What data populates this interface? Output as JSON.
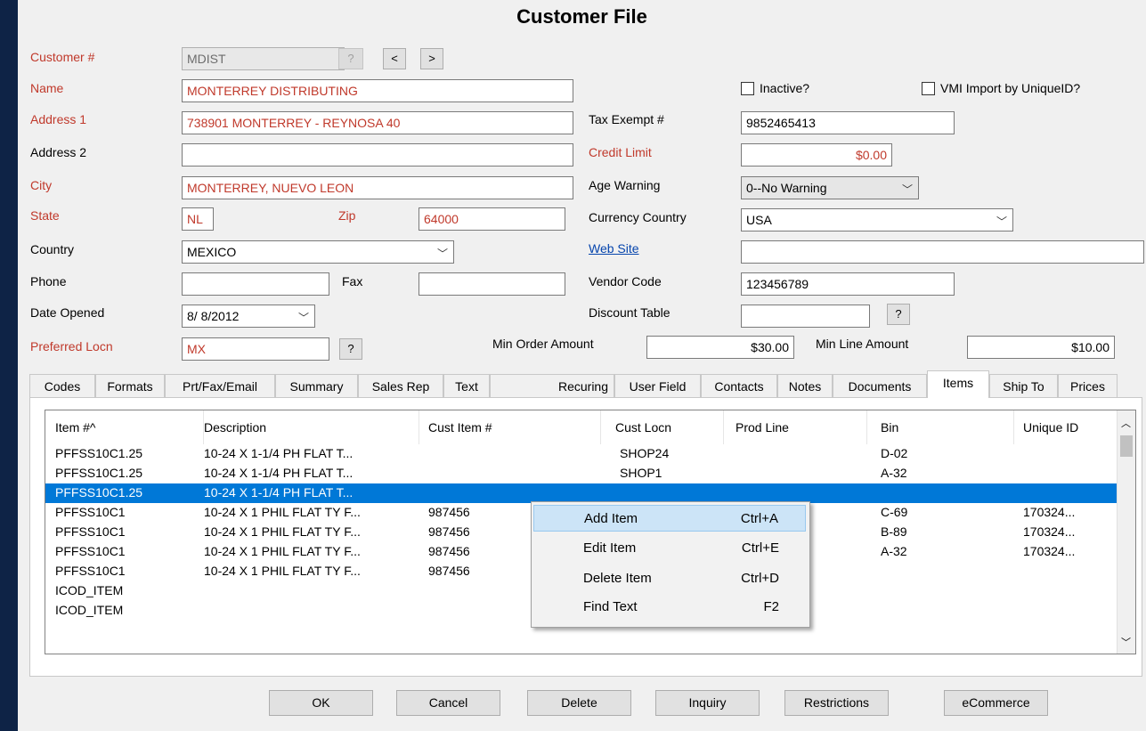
{
  "window": {
    "title": "Customer File"
  },
  "left": {
    "customer_label": "Customer #",
    "customer_value": "MDIST",
    "help": "?",
    "prev": "<",
    "next": ">",
    "name_label": "Name",
    "name_value": "MONTERREY DISTRIBUTING",
    "addr1_label": "Address 1",
    "addr1_value": "738901 MONTERREY - REYNOSA 40",
    "addr2_label": "Address 2",
    "addr2_value": "",
    "city_label": "City",
    "city_value": "MONTERREY, NUEVO LEON",
    "state_label": "State",
    "state_value": "NL",
    "zip_label": "Zip",
    "zip_value": "64000",
    "country_label": "Country",
    "country_value": "MEXICO",
    "phone_label": "Phone",
    "phone_value": "",
    "fax_label": "Fax",
    "fax_value": "",
    "date_label": "Date Opened",
    "date_value": "8/ 8/2012",
    "locn_label": "Preferred Locn",
    "locn_value": "MX"
  },
  "right": {
    "inactive_label": "Inactive?",
    "vmi_label": "VMI Import by UniqueID?",
    "tax_label": "Tax Exempt #",
    "tax_value": "9852465413",
    "credit_label": "Credit Limit",
    "credit_value": "$0.00",
    "age_label": "Age Warning",
    "age_value": "0--No Warning",
    "currency_label": "Currency Country",
    "currency_value": "USA",
    "web_label": "Web Site",
    "web_value": "",
    "vendor_label": "Vendor Code",
    "vendor_value": "123456789",
    "discount_label": "Discount Table",
    "discount_value": "",
    "minorder_label": "Min Order Amount",
    "minorder_value": "$30.00",
    "minline_label": "Min Line Amount",
    "minline_value": "$10.00"
  },
  "tabs": [
    "Codes",
    "Formats",
    "Prt/Fax/Email",
    "Summary",
    "Sales Rep",
    "Text",
    "Recuring",
    "User Field",
    "Contacts",
    "Notes",
    "Documents",
    "Items",
    "Ship To",
    "Prices"
  ],
  "active_tab": "Items",
  "table": {
    "headers": [
      "Item #^",
      "Description",
      "Cust Item #",
      "Cust Locn",
      "Prod Line",
      "Bin",
      "Unique ID"
    ],
    "rows": [
      [
        "PFFSS10C1.25",
        "10-24 X 1-1/4 PH FLAT T...",
        "",
        "SHOP24",
        "",
        "D-02",
        ""
      ],
      [
        "PFFSS10C1.25",
        "10-24 X 1-1/4 PH FLAT T...",
        "",
        "SHOP1",
        "",
        "A-32",
        ""
      ],
      [
        "PFFSS10C1.25",
        "10-24 X 1-1/4 PH FLAT T...",
        "",
        "",
        "",
        "",
        ""
      ],
      [
        "PFFSS10C1",
        "10-24 X 1 PHIL FLAT TY F...",
        "987456",
        "",
        "",
        "C-69",
        "170324..."
      ],
      [
        "PFFSS10C1",
        "10-24 X 1 PHIL FLAT TY F...",
        "987456",
        "",
        "",
        "B-89",
        "170324..."
      ],
      [
        "PFFSS10C1",
        "10-24 X 1 PHIL FLAT TY F...",
        "987456",
        "",
        "",
        "A-32",
        "170324..."
      ],
      [
        "PFFSS10C1",
        "10-24 X 1 PHIL FLAT TY F...",
        "987456",
        "",
        "",
        "",
        ""
      ],
      [
        "ICOD_ITEM",
        "",
        "",
        "",
        "",
        "",
        ""
      ],
      [
        "ICOD_ITEM",
        "",
        "",
        "",
        "",
        "",
        ""
      ]
    ],
    "selected_row": 2
  },
  "context_menu": [
    {
      "label": "Add Item",
      "shortcut": "Ctrl+A"
    },
    {
      "label": "Edit Item",
      "shortcut": "Ctrl+E"
    },
    {
      "label": "Delete Item",
      "shortcut": "Ctrl+D"
    },
    {
      "label": "Find Text",
      "shortcut": "F2"
    }
  ],
  "buttons": {
    "ok": "OK",
    "cancel": "Cancel",
    "delete": "Delete",
    "inquiry": "Inquiry",
    "restrictions": "Restrictions",
    "ecommerce": "eCommerce"
  },
  "colors": {
    "required_label": "#c0392b",
    "selection": "#0078d7",
    "menu_highlight": "#cce4f7",
    "link": "#0645ad"
  }
}
